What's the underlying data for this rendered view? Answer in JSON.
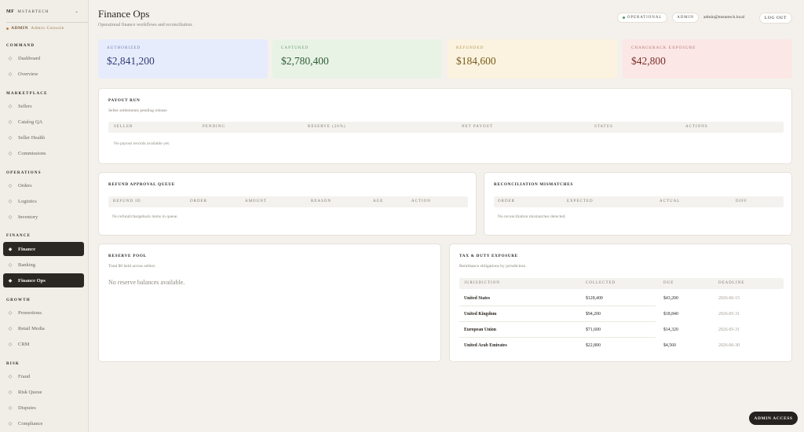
{
  "brand": {
    "logo": "MF",
    "name": "MSTARTECH",
    "caret": "⌄"
  },
  "console": {
    "role": "ADMIN",
    "label": "Admin Console"
  },
  "sidebar": {
    "sections": [
      {
        "label": "COMMAND",
        "items": [
          {
            "label": "Dashboard",
            "icon": "◇"
          },
          {
            "label": "Overview",
            "icon": "◇"
          }
        ]
      },
      {
        "label": "MARKETPLACE",
        "items": [
          {
            "label": "Sellers",
            "icon": "◇"
          },
          {
            "label": "Catalog QA",
            "icon": "◇"
          },
          {
            "label": "Seller Health",
            "icon": "◇"
          },
          {
            "label": "Commissions",
            "icon": "◇"
          }
        ]
      },
      {
        "label": "OPERATIONS",
        "items": [
          {
            "label": "Orders",
            "icon": "◇"
          },
          {
            "label": "Logistics",
            "icon": "◇"
          },
          {
            "label": "Inventory",
            "icon": "◇"
          }
        ]
      },
      {
        "label": "FINANCE",
        "items": [
          {
            "label": "Finance",
            "icon": "◆"
          },
          {
            "label": "Banking",
            "icon": "◇"
          },
          {
            "label": "Finance Ops",
            "icon": "◆"
          }
        ]
      },
      {
        "label": "GROWTH",
        "items": [
          {
            "label": "Promotions",
            "icon": "◇"
          },
          {
            "label": "Retail Media",
            "icon": "◇"
          },
          {
            "label": "CRM",
            "icon": "◇"
          }
        ]
      },
      {
        "label": "RISK",
        "items": [
          {
            "label": "Fraud",
            "icon": "◇"
          },
          {
            "label": "Risk Queue",
            "icon": "◇"
          },
          {
            "label": "Disputes",
            "icon": "◇"
          },
          {
            "label": "Compliance",
            "icon": "◇"
          }
        ]
      }
    ]
  },
  "header": {
    "title": "Finance Ops",
    "subtitle": "Operational finance workflows and reconciliation.",
    "status": "OPERATIONAL",
    "role": "ADMIN",
    "email": "admin@mstartech.local",
    "logout": "LOG OUT"
  },
  "kpis": [
    {
      "label": "AUTHORIZED",
      "value": "$2,841,200"
    },
    {
      "label": "CAPTURED",
      "value": "$2,780,400"
    },
    {
      "label": "REFUNDED",
      "value": "$184,600"
    },
    {
      "label": "CHARGEBACK EXPOSURE",
      "value": "$42,800"
    }
  ],
  "colors": {
    "authorized": "#e6ecfb",
    "captured": "#e8f3e6",
    "refunded": "#fbf3df",
    "chargeback": "#fbe7e5"
  },
  "payout": {
    "title": "PAYOUT RUN",
    "subtitle": "Seller settlements pending release",
    "columns": [
      "SELLER",
      "PENDING",
      "RESERVE (20%)",
      "NET PAYOUT",
      "STATUS",
      "ACTIONS"
    ],
    "empty": "No payout records available yet."
  },
  "refund": {
    "title": "REFUND APPROVAL QUEUE",
    "columns": [
      "REFUND ID",
      "ORDER",
      "AMOUNT",
      "REASON",
      "AGE",
      "ACTION"
    ],
    "empty": "No refund/chargeback items in queue."
  },
  "recon": {
    "title": "RECONCILIATION MISMATCHES",
    "columns": [
      "ORDER",
      "EXPECTED",
      "ACTUAL",
      "DIFF"
    ],
    "empty": "No reconciliation mismatches detected."
  },
  "reserve": {
    "title": "RESERVE POOL",
    "subtitle": "Total $0 held across sellers",
    "empty": "No reserve balances available."
  },
  "tax": {
    "title": "TAX & DUTY EXPOSURE",
    "subtitle": "Remittance obligations by jurisdiction",
    "columns": [
      "JURISDICTION",
      "COLLECTED",
      "DUE",
      "DEADLINE"
    ],
    "rows": [
      {
        "jurisdiction": "United States",
        "collected": "$128,400",
        "due": "$43,200",
        "deadline": "2026-06-15"
      },
      {
        "jurisdiction": "United Kingdom",
        "collected": "$94,200",
        "due": "$18,840",
        "deadline": "2026-05-31"
      },
      {
        "jurisdiction": "European Union",
        "collected": "$71,600",
        "due": "$14,320",
        "deadline": "2026-05-31"
      },
      {
        "jurisdiction": "United Arab Emirates",
        "collected": "$22,800",
        "due": "$4,560",
        "deadline": "2026-06-30"
      }
    ]
  },
  "admin_access": "ADMIN ACCESS"
}
